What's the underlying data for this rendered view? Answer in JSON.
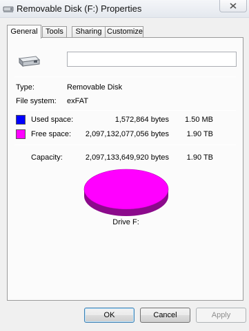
{
  "window": {
    "title": "Removable Disk (F:) Properties"
  },
  "tabs": [
    {
      "label": "General",
      "active": true
    },
    {
      "label": "Tools",
      "active": false
    },
    {
      "label": "Sharing",
      "active": false
    },
    {
      "label": "Customize",
      "active": false
    }
  ],
  "general": {
    "name_value": "",
    "type_label": "Type:",
    "type_value": "Removable Disk",
    "fs_label": "File system:",
    "fs_value": "exFAT",
    "used": {
      "label": "Used space:",
      "bytes": "1,572,864 bytes",
      "size": "1.50 MB",
      "color": "#0000ff"
    },
    "free": {
      "label": "Free space:",
      "bytes": "2,097,132,077,056 bytes",
      "size": "1.90 TB",
      "color": "#ff00ff"
    },
    "capacity": {
      "label": "Capacity:",
      "bytes": "2,097,133,649,920 bytes",
      "size": "1.90 TB"
    },
    "drive_label": "Drive F:"
  },
  "chart_data": {
    "type": "pie",
    "categories": [
      "Used space",
      "Free space"
    ],
    "values": [
      1572864,
      2097132077056
    ]
  },
  "buttons": {
    "ok": "OK",
    "cancel": "Cancel",
    "apply": "Apply"
  }
}
